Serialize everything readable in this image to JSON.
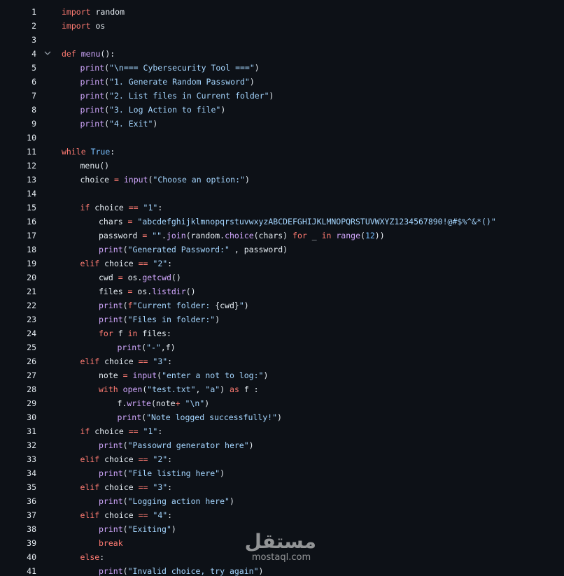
{
  "watermark": {
    "logo_text": "مستقل",
    "domain": "mostaql.com"
  },
  "fold_icon": "chevron-down-icon",
  "lines": [
    {
      "n": "1",
      "indent": 0,
      "tokens": [
        [
          "k",
          "import"
        ],
        [
          "p",
          " random"
        ]
      ]
    },
    {
      "n": "2",
      "indent": 0,
      "tokens": [
        [
          "k",
          "import"
        ],
        [
          "p",
          " os"
        ]
      ]
    },
    {
      "n": "3",
      "indent": 0,
      "tokens": []
    },
    {
      "n": "4",
      "indent": 0,
      "fold": true,
      "tokens": [
        [
          "k",
          "def"
        ],
        [
          "p",
          " "
        ],
        [
          "f",
          "menu"
        ],
        [
          "p",
          "():"
        ]
      ]
    },
    {
      "n": "5",
      "indent": 1,
      "tokens": [
        [
          "f",
          "print"
        ],
        [
          "p",
          "("
        ],
        [
          "s",
          "\"\\n=== Cybersecurity Tool ===\""
        ],
        [
          "p",
          ")"
        ]
      ]
    },
    {
      "n": "6",
      "indent": 1,
      "tokens": [
        [
          "f",
          "print"
        ],
        [
          "p",
          "("
        ],
        [
          "s",
          "\"1. Generate Random Password\""
        ],
        [
          "p",
          ")"
        ]
      ]
    },
    {
      "n": "7",
      "indent": 1,
      "tokens": [
        [
          "f",
          "print"
        ],
        [
          "p",
          "("
        ],
        [
          "s",
          "\"2. List files in Current folder\""
        ],
        [
          "p",
          ")"
        ]
      ]
    },
    {
      "n": "8",
      "indent": 1,
      "tokens": [
        [
          "f",
          "print"
        ],
        [
          "p",
          "("
        ],
        [
          "s",
          "\"3. Log Action to file\""
        ],
        [
          "p",
          ")"
        ]
      ]
    },
    {
      "n": "9",
      "indent": 1,
      "tokens": [
        [
          "f",
          "print"
        ],
        [
          "p",
          "("
        ],
        [
          "s",
          "\"4. Exit\""
        ],
        [
          "p",
          ")"
        ]
      ]
    },
    {
      "n": "10",
      "indent": 0,
      "tokens": []
    },
    {
      "n": "11",
      "indent": 0,
      "tokens": [
        [
          "k",
          "while"
        ],
        [
          "p",
          " "
        ],
        [
          "c",
          "True"
        ],
        [
          "p",
          ":"
        ]
      ]
    },
    {
      "n": "12",
      "indent": 1,
      "tokens": [
        [
          "p",
          "menu()"
        ]
      ]
    },
    {
      "n": "13",
      "indent": 1,
      "tokens": [
        [
          "p",
          "choice "
        ],
        [
          "k",
          "="
        ],
        [
          "p",
          " "
        ],
        [
          "f",
          "input"
        ],
        [
          "p",
          "("
        ],
        [
          "s",
          "\"Choose an option:\""
        ],
        [
          "p",
          ")"
        ]
      ]
    },
    {
      "n": "14",
      "indent": 0,
      "tokens": []
    },
    {
      "n": "15",
      "indent": 1,
      "tokens": [
        [
          "k",
          "if"
        ],
        [
          "p",
          " choice "
        ],
        [
          "k",
          "=="
        ],
        [
          "p",
          " "
        ],
        [
          "s",
          "\"1\""
        ],
        [
          "p",
          ":"
        ]
      ]
    },
    {
      "n": "16",
      "indent": 2,
      "tokens": [
        [
          "p",
          "chars "
        ],
        [
          "k",
          "="
        ],
        [
          "p",
          " "
        ],
        [
          "s",
          "\"abcdefghijklmnopqrstuvwxyzABCDEFGHIJKLMNOPQRSTUVWXYZ1234567890!@#$%^&*()\""
        ]
      ]
    },
    {
      "n": "17",
      "indent": 2,
      "tokens": [
        [
          "p",
          "password "
        ],
        [
          "k",
          "="
        ],
        [
          "p",
          " "
        ],
        [
          "s",
          "\"\""
        ],
        [
          "p",
          "."
        ],
        [
          "f",
          "join"
        ],
        [
          "p",
          "(random."
        ],
        [
          "f",
          "choice"
        ],
        [
          "p",
          "(chars) "
        ],
        [
          "k",
          "for"
        ],
        [
          "p",
          " _ "
        ],
        [
          "k",
          "in"
        ],
        [
          "p",
          " "
        ],
        [
          "f",
          "range"
        ],
        [
          "p",
          "("
        ],
        [
          "c",
          "12"
        ],
        [
          "p",
          "))"
        ]
      ]
    },
    {
      "n": "18",
      "indent": 2,
      "tokens": [
        [
          "f",
          "print"
        ],
        [
          "p",
          "("
        ],
        [
          "s",
          "\"Generated Password:\""
        ],
        [
          "p",
          " , password)"
        ]
      ]
    },
    {
      "n": "19",
      "indent": 1,
      "tokens": [
        [
          "k",
          "elif"
        ],
        [
          "p",
          " choice "
        ],
        [
          "k",
          "=="
        ],
        [
          "p",
          " "
        ],
        [
          "s",
          "\"2\""
        ],
        [
          "p",
          ":"
        ]
      ]
    },
    {
      "n": "20",
      "indent": 2,
      "tokens": [
        [
          "p",
          "cwd "
        ],
        [
          "k",
          "="
        ],
        [
          "p",
          " os."
        ],
        [
          "f",
          "getcwd"
        ],
        [
          "p",
          "()"
        ]
      ]
    },
    {
      "n": "21",
      "indent": 2,
      "tokens": [
        [
          "p",
          "files "
        ],
        [
          "k",
          "="
        ],
        [
          "p",
          " os."
        ],
        [
          "f",
          "listdir"
        ],
        [
          "p",
          "()"
        ]
      ]
    },
    {
      "n": "22",
      "indent": 2,
      "tokens": [
        [
          "f",
          "print"
        ],
        [
          "p",
          "("
        ],
        [
          "k",
          "f"
        ],
        [
          "s",
          "\"Current folder: "
        ],
        [
          "p",
          "{cwd}"
        ],
        [
          "s",
          "\""
        ],
        [
          "p",
          ")"
        ]
      ]
    },
    {
      "n": "23",
      "indent": 2,
      "tokens": [
        [
          "f",
          "print"
        ],
        [
          "p",
          "("
        ],
        [
          "s",
          "\"Files in folder:\""
        ],
        [
          "p",
          ")"
        ]
      ]
    },
    {
      "n": "24",
      "indent": 2,
      "tokens": [
        [
          "k",
          "for"
        ],
        [
          "p",
          " f "
        ],
        [
          "k",
          "in"
        ],
        [
          "p",
          " files:"
        ]
      ]
    },
    {
      "n": "25",
      "indent": 3,
      "tokens": [
        [
          "f",
          "print"
        ],
        [
          "p",
          "("
        ],
        [
          "s",
          "\"-\""
        ],
        [
          "p",
          ",f)"
        ]
      ]
    },
    {
      "n": "26",
      "indent": 1,
      "tokens": [
        [
          "k",
          "elif"
        ],
        [
          "p",
          " choice "
        ],
        [
          "k",
          "=="
        ],
        [
          "p",
          " "
        ],
        [
          "s",
          "\"3\""
        ],
        [
          "p",
          ":"
        ]
      ]
    },
    {
      "n": "27",
      "indent": 2,
      "tokens": [
        [
          "p",
          "note "
        ],
        [
          "k",
          "="
        ],
        [
          "p",
          " "
        ],
        [
          "f",
          "input"
        ],
        [
          "p",
          "("
        ],
        [
          "s",
          "\"enter a not to log:\""
        ],
        [
          "p",
          ")"
        ]
      ]
    },
    {
      "n": "28",
      "indent": 2,
      "tokens": [
        [
          "k",
          "with"
        ],
        [
          "p",
          " "
        ],
        [
          "f",
          "open"
        ],
        [
          "p",
          "("
        ],
        [
          "s",
          "\"test.txt\""
        ],
        [
          "p",
          ", "
        ],
        [
          "s",
          "\"a\""
        ],
        [
          "p",
          ") "
        ],
        [
          "k",
          "as"
        ],
        [
          "p",
          " f :"
        ]
      ]
    },
    {
      "n": "29",
      "indent": 3,
      "tokens": [
        [
          "p",
          "f."
        ],
        [
          "f",
          "write"
        ],
        [
          "p",
          "(note"
        ],
        [
          "k",
          "+"
        ],
        [
          "p",
          " "
        ],
        [
          "s",
          "\"\\n\""
        ],
        [
          "p",
          ")"
        ]
      ]
    },
    {
      "n": "30",
      "indent": 3,
      "tokens": [
        [
          "f",
          "print"
        ],
        [
          "p",
          "("
        ],
        [
          "s",
          "\"Note logged successfully!\""
        ],
        [
          "p",
          ")"
        ]
      ]
    },
    {
      "n": "31",
      "indent": 1,
      "tokens": [
        [
          "k",
          "if"
        ],
        [
          "p",
          " choice "
        ],
        [
          "k",
          "=="
        ],
        [
          "p",
          " "
        ],
        [
          "s",
          "\"1\""
        ],
        [
          "p",
          ":"
        ]
      ]
    },
    {
      "n": "32",
      "indent": 2,
      "tokens": [
        [
          "f",
          "print"
        ],
        [
          "p",
          "("
        ],
        [
          "s",
          "\"Passowrd generator here\""
        ],
        [
          "p",
          ")"
        ]
      ]
    },
    {
      "n": "33",
      "indent": 1,
      "tokens": [
        [
          "k",
          "elif"
        ],
        [
          "p",
          " choice "
        ],
        [
          "k",
          "=="
        ],
        [
          "p",
          " "
        ],
        [
          "s",
          "\"2\""
        ],
        [
          "p",
          ":"
        ]
      ]
    },
    {
      "n": "34",
      "indent": 2,
      "tokens": [
        [
          "f",
          "print"
        ],
        [
          "p",
          "("
        ],
        [
          "s",
          "\"File listing here\""
        ],
        [
          "p",
          ")"
        ]
      ]
    },
    {
      "n": "35",
      "indent": 1,
      "tokens": [
        [
          "k",
          "elif"
        ],
        [
          "p",
          " choice "
        ],
        [
          "k",
          "=="
        ],
        [
          "p",
          " "
        ],
        [
          "s",
          "\"3\""
        ],
        [
          "p",
          ":"
        ]
      ]
    },
    {
      "n": "36",
      "indent": 2,
      "tokens": [
        [
          "f",
          "print"
        ],
        [
          "p",
          "("
        ],
        [
          "s",
          "\"Logging action here\""
        ],
        [
          "p",
          ")"
        ]
      ]
    },
    {
      "n": "37",
      "indent": 1,
      "tokens": [
        [
          "k",
          "elif"
        ],
        [
          "p",
          " choice "
        ],
        [
          "k",
          "=="
        ],
        [
          "p",
          " "
        ],
        [
          "s",
          "\"4\""
        ],
        [
          "p",
          ":"
        ]
      ]
    },
    {
      "n": "38",
      "indent": 2,
      "tokens": [
        [
          "f",
          "print"
        ],
        [
          "p",
          "("
        ],
        [
          "s",
          "\"Exiting\""
        ],
        [
          "p",
          ")"
        ]
      ]
    },
    {
      "n": "39",
      "indent": 2,
      "tokens": [
        [
          "k",
          "break"
        ]
      ]
    },
    {
      "n": "40",
      "indent": 1,
      "tokens": [
        [
          "k",
          "else"
        ],
        [
          "p",
          ":"
        ]
      ]
    },
    {
      "n": "41",
      "indent": 2,
      "tokens": [
        [
          "f",
          "print"
        ],
        [
          "p",
          "("
        ],
        [
          "s",
          "\"Invalid choice, try again\""
        ],
        [
          "p",
          ")"
        ]
      ]
    }
  ]
}
